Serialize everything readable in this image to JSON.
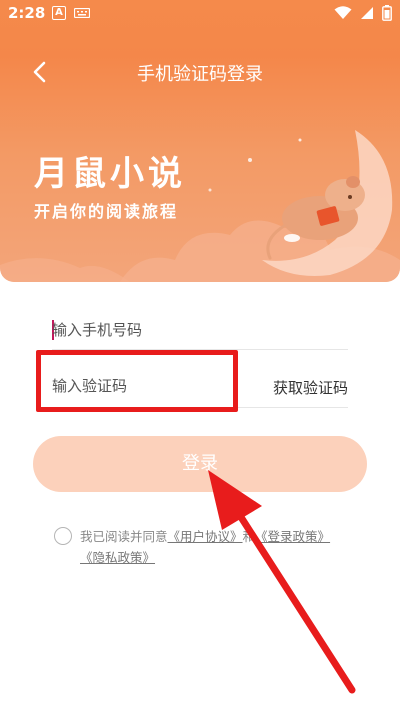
{
  "status_bar": {
    "time": "2:28",
    "icons": [
      "notification-a-icon",
      "keyboard-icon",
      "wifi-icon",
      "signal-icon",
      "battery-icon"
    ]
  },
  "nav": {
    "title": "手机验证码登录",
    "back_icon": "chevron-left-icon"
  },
  "banner": {
    "title": "月鼠小说",
    "subtitle": "开启你的阅读旅程"
  },
  "form": {
    "phone_placeholder": "输入手机号码",
    "code_placeholder": "输入验证码",
    "get_code_label": "获取验证码",
    "login_label": "登录"
  },
  "agreement": {
    "prefix": "我已阅读并同意",
    "user_agreement": "《用户协议》",
    "and": "和",
    "login_policy": "《登录政策》",
    "privacy_policy": "《隐私政策》"
  },
  "colors": {
    "header_orange": "#f58a4b",
    "button_disabled": "#fcd1bb",
    "annotation_red": "#e81c1c"
  }
}
